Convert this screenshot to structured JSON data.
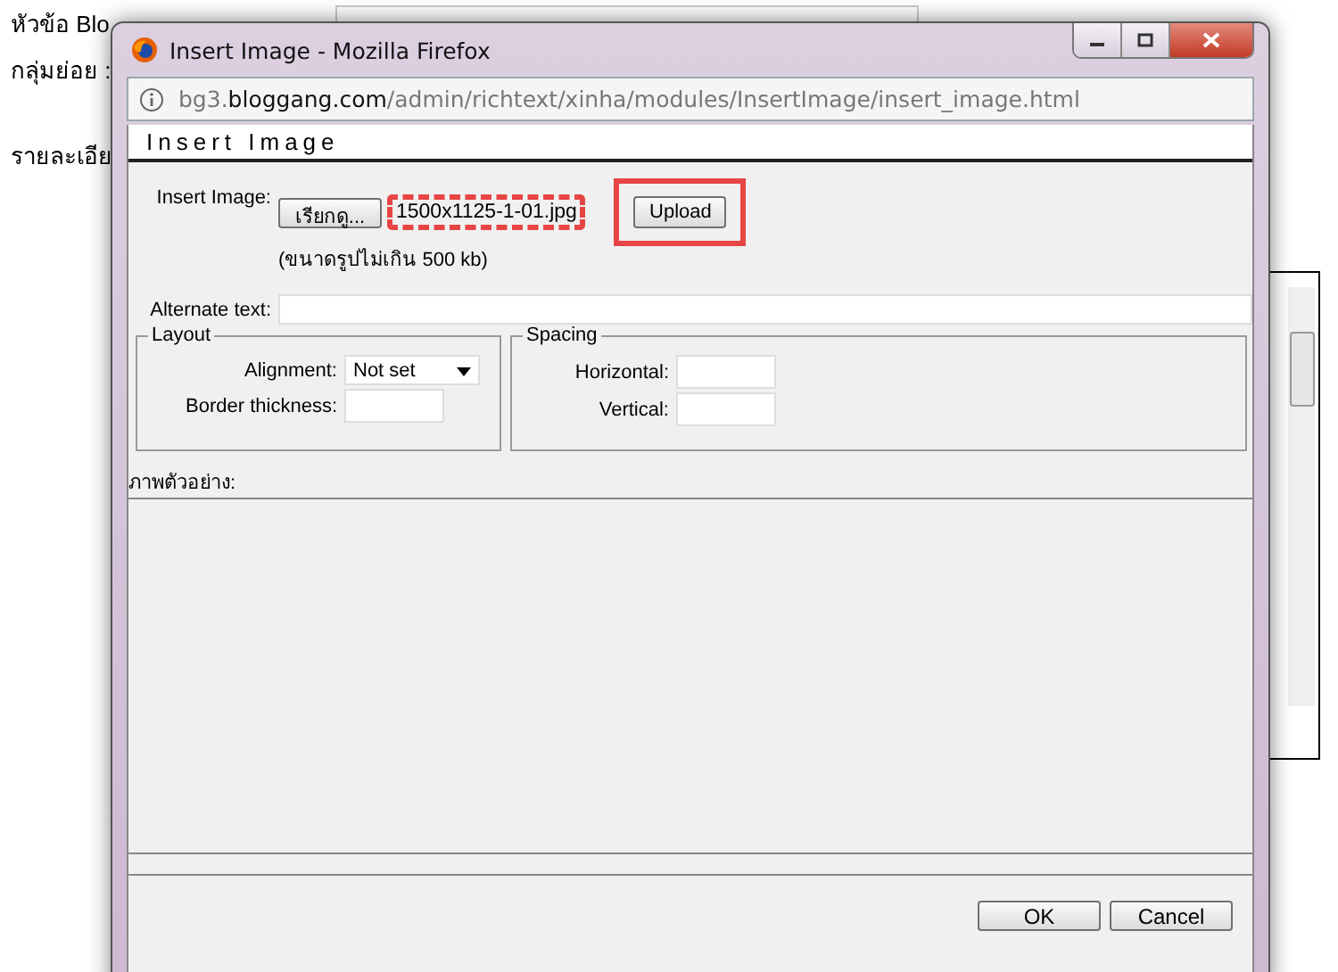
{
  "background": {
    "labels": [
      "หัวข้อ Blo",
      "กลุ่มย่อย :",
      "รายละเอีย"
    ]
  },
  "window": {
    "title": "Insert Image - Mozilla Firefox",
    "url": "bg3.**bloggang.com**/admin/richtext/xinha/modules/InsertImage/insert_image.html"
  },
  "dialog": {
    "heading": "Insert Image",
    "insert_image": {
      "label": "Insert Image:",
      "browse_button": "เรียกดู...",
      "filename": "1500x1125-1-01.jpg",
      "hint": "(ขนาดรูปไม่เกิน 500 kb)",
      "upload_button": "Upload"
    },
    "alternate_text": {
      "label": "Alternate text:"
    },
    "layout": {
      "legend": "Layout",
      "alignment_label": "Alignment:",
      "alignment_value": "Not set",
      "border_label": "Border thickness:"
    },
    "spacing": {
      "legend": "Spacing",
      "horizontal_label": "Horizontal:",
      "vertical_label": "Vertical:"
    },
    "preview_label": "ภาพตัวอย่าง:",
    "buttons": [
      "OK",
      "Cancel"
    ]
  }
}
